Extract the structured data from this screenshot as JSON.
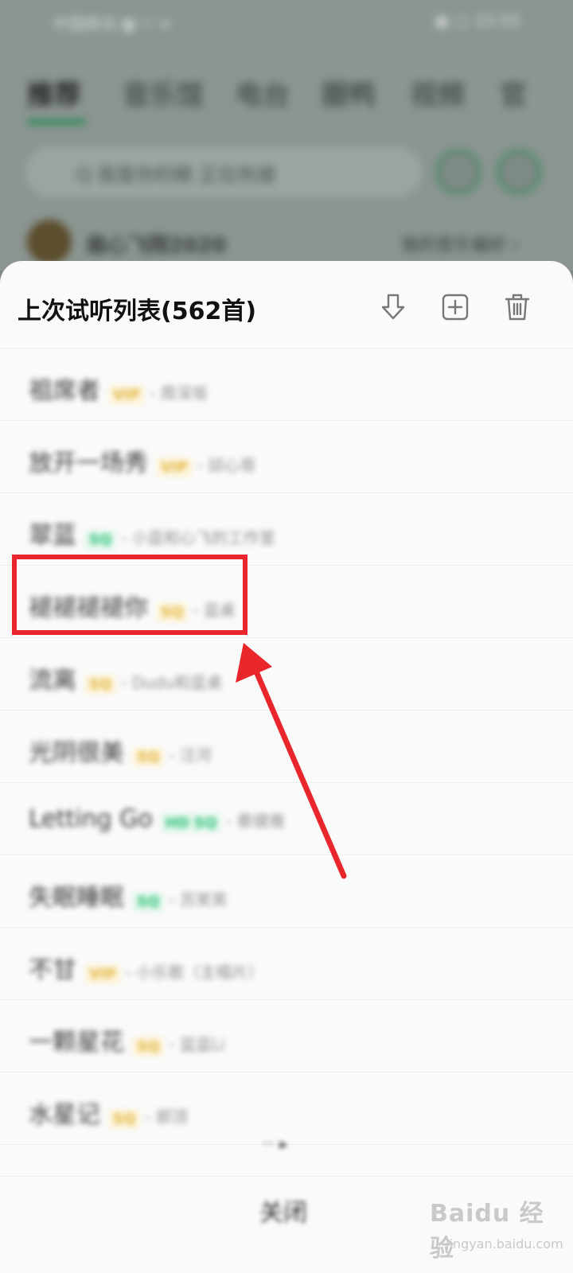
{
  "background_app": {
    "status_left": "中国移动 ▩ ᵞᵢˡ ᯤ",
    "status_right": "▣ ▢ 15:55",
    "tabs": [
      "推荐",
      "音乐馆",
      "电台",
      "圈鸭",
      "视频",
      "官"
    ],
    "search_placeholder": "Q  我是你的眼  正在热搜",
    "user_name": "扇心飞翔2020",
    "user_right": "我的音乐偏好 ›"
  },
  "sheet": {
    "title": "上次试听列表(562首)",
    "download_icon": "download-icon",
    "add_icon": "add-to-playlist-icon",
    "delete_icon": "trash-icon",
    "songs": [
      {
        "title": "祖席者",
        "badge": "VIP",
        "badge_color": "gold",
        "artist": "- 周深坂"
      },
      {
        "title": "放开一场秀",
        "badge": "VIP",
        "badge_color": "gold",
        "artist": "- 邱心哥"
      },
      {
        "title": "翠蓝",
        "badge": "SQ",
        "badge_color": "green",
        "artist": "- 小蓝和心飞的工作室"
      },
      {
        "title": "褪褪褪褪你",
        "badge": "SQ",
        "badge_color": "gold",
        "artist": "- 蓝桌"
      },
      {
        "title": "流离",
        "badge": "SQ",
        "badge_color": "gold",
        "artist": "- Dudu和蓝桌"
      },
      {
        "title": "光阴很美",
        "badge": "SQ",
        "badge_color": "gold",
        "artist": "- 汪河"
      },
      {
        "title": "Letting Go",
        "badge": "HD SQ",
        "badge_color": "green",
        "artist": "- 蔡健雅"
      },
      {
        "title": "失眠睡眠",
        "badge": "SQ",
        "badge_color": "green",
        "artist": "- 苏笑笑"
      },
      {
        "title": "不甘",
        "badge": "VIP",
        "badge_color": "gold",
        "artist": "- 小乐歌（主唱片）"
      },
      {
        "title": "一颗星花",
        "badge": "SQ",
        "badge_color": "gold",
        "artist": "- 蓝蓝Li"
      },
      {
        "title": "水星记",
        "badge": "SQ",
        "badge_color": "gold",
        "artist": "- 郭顶"
      }
    ],
    "more_label": "·· ▸",
    "close_label": "关闭"
  },
  "annotation": {
    "highlight_color": "#e8262b"
  },
  "watermark": {
    "brand": "Baidu 经验",
    "url": "jingyan.baidu.com"
  }
}
